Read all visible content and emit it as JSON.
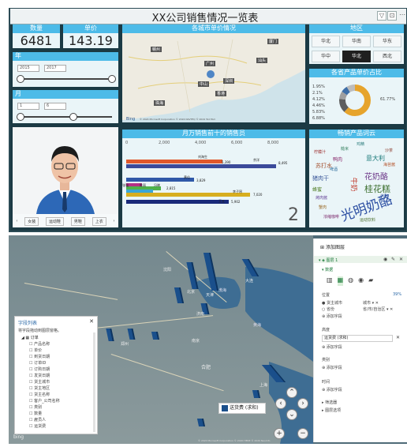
{
  "dashboard": {
    "title": "XX公司销售情况一览表",
    "kpi": {
      "count_label": "数量",
      "count_value": "6481",
      "price_label": "单价",
      "price_value": "143.19 千"
    },
    "year_slicer": {
      "label": "年",
      "from": "2015",
      "to": "2017"
    },
    "month_slicer": {
      "label": "月",
      "from": "1",
      "to": "6"
    },
    "map_title": "各城市单价情况",
    "map_labels": [
      "赣州",
      "厦门",
      "汕头",
      "深圳",
      "珠海",
      "广州",
      "中山",
      "香港"
    ],
    "map_copyright": "© 2024 Microsoft Corporation   © 2024 NAVTEQ   © 2024 TomTom",
    "map_brand": "Bing",
    "region_title": "地区",
    "region_buttons": [
      "华北",
      "华南",
      "华东",
      "华中",
      "华北",
      "西北"
    ],
    "region_active_index": 4,
    "donut_title": "各省产品单价占比",
    "donut_labels": [
      "1.95%",
      "2.1%",
      "4.12%",
      "4.46%",
      "5.83%",
      "6.88%",
      "61.77%"
    ],
    "bar_title": "月万销售前十的销售员",
    "bar_axis": [
      "0",
      "2,000",
      "4,000",
      "6,000",
      "8,000"
    ],
    "bar_names": [
      "刘海生",
      "余洋",
      "黄佳",
      "张强",
      "陈丽",
      "冯晓",
      "李子昂",
      "王五"
    ],
    "bar_values": [
      "5,390",
      "8,495",
      "3,829",
      "3,210",
      "2,815",
      "1,912",
      "7,020",
      "5,902"
    ],
    "wordcloud_title": "畅销产品词云",
    "wordcloud_words": [
      "光明奶酪",
      "桂花糕",
      "花奶酪",
      "牛奶",
      "意大利",
      "苏打水",
      "猪肉干",
      "鸭肉",
      "蜂蜜",
      "柠檬汁",
      "啤酒",
      "烤肉酱",
      "海苔酱",
      "糙米",
      "蟹肉",
      "汽水",
      "浓缩咖啡",
      "鸡精",
      "沙茶",
      "运动饮料"
    ],
    "person_nav": [
      "女装",
      "运动鞋",
      "男鞋",
      "上衣"
    ],
    "page_number": "2"
  },
  "bottom_map": {
    "map_labels": [
      "北京",
      "天津",
      "大连",
      "沈阳",
      "郑州",
      "南京",
      "合肥",
      "黄海",
      "渤海",
      "济南",
      "上海"
    ],
    "legend_label": "送货费 (求和)",
    "copyright": "© 2020 Microsoft Corporation  © 2020 HERE  © 2020 Navinfo",
    "brand": "bing",
    "field_list": {
      "title": "字段列表",
      "subtitle": "将字段拖动到图层窗格。",
      "table": "订单",
      "items": [
        "产品名称",
        "单价",
        "到货日期",
        "订单ID",
        "订购日期",
        "发货日期",
        "货主城市",
        "货主地区",
        "货主名称",
        "客户_公司名称",
        "类别",
        "数量",
        "雇员人",
        "运货费"
      ]
    },
    "layer_pane": {
      "add_layer": "添加图层",
      "layer_name": "图层 1",
      "data_section": "数据",
      "location_label": "位置",
      "location_pct": "39%",
      "location_fields": [
        {
          "name": "货主城市",
          "type": "城市"
        },
        {
          "name": "省份",
          "type": "省/市/自治区"
        }
      ],
      "add_field": "添加字段",
      "height_label": "高度",
      "height_field": "运货费 (求和)",
      "category_label": "类别",
      "time_label": "时间",
      "filter_label": "筛选器",
      "layer_options_label": "图层选项"
    }
  }
}
